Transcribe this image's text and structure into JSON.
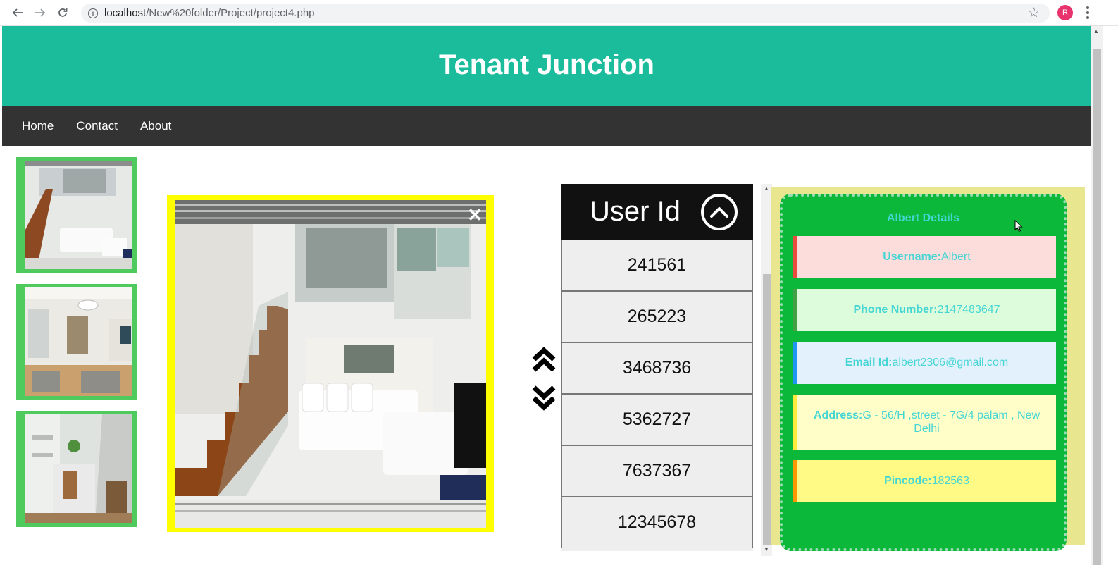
{
  "browser": {
    "url_host": "localhost",
    "url_path": "/New%20folder/Project/project4.php",
    "profile_initial": "R"
  },
  "header": {
    "title": "Tenant Junction"
  },
  "nav": {
    "items": [
      "Home",
      "Contact",
      "About"
    ]
  },
  "user_list": {
    "heading": "User Id",
    "ids": [
      "241561",
      "265223",
      "3468736",
      "5362727",
      "7637367",
      "12345678"
    ]
  },
  "details": {
    "title": "Albert Details",
    "username_label": "Username:",
    "username_value": "Albert",
    "phone_label": "Phone Number:",
    "phone_value": "2147483647",
    "email_label": "Email Id:",
    "email_value": "albert2306@gmail.com",
    "address_label": "Address:",
    "address_value": "G - 56/H ,street - 7G/4 palam , New Delhi",
    "pincode_label": "Pincode:",
    "pincode_value": "182563"
  },
  "icons": {
    "back": "arrow-left-icon",
    "forward": "arrow-right-icon",
    "reload": "reload-icon",
    "info": "info-icon",
    "star": "star-icon",
    "close": "close-icon",
    "scroll_up": "chevron-double-up-icon",
    "scroll_down": "chevron-double-down-icon",
    "circle_up": "circle-chevron-up-icon"
  },
  "colors": {
    "header_bg": "#1abc9c",
    "nav_bg": "#333333",
    "thumb_frame": "#4fcb5d",
    "photo_frame": "#ffff00",
    "details_card": "#0bb83a",
    "details_text": "#45d6d4"
  }
}
